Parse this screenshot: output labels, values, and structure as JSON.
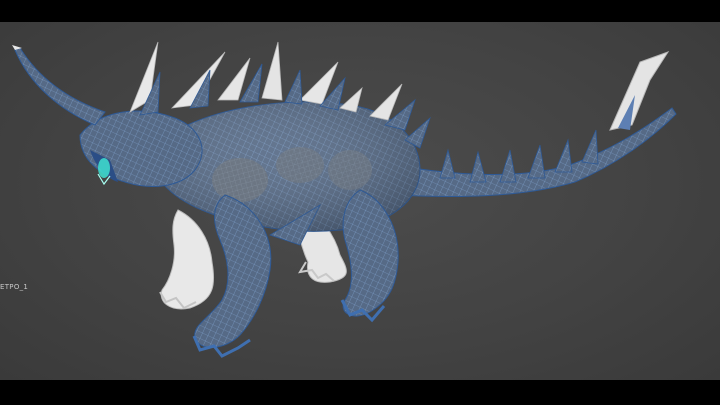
{
  "viewport": {
    "object_label": "ETPO_1",
    "background_color": "#454545",
    "mesh_color": "#3f6fb0",
    "wire_color": "#8fb7e8",
    "spike_color": "#e9e9e9",
    "eye_glow_color": "#3fe0d0"
  }
}
